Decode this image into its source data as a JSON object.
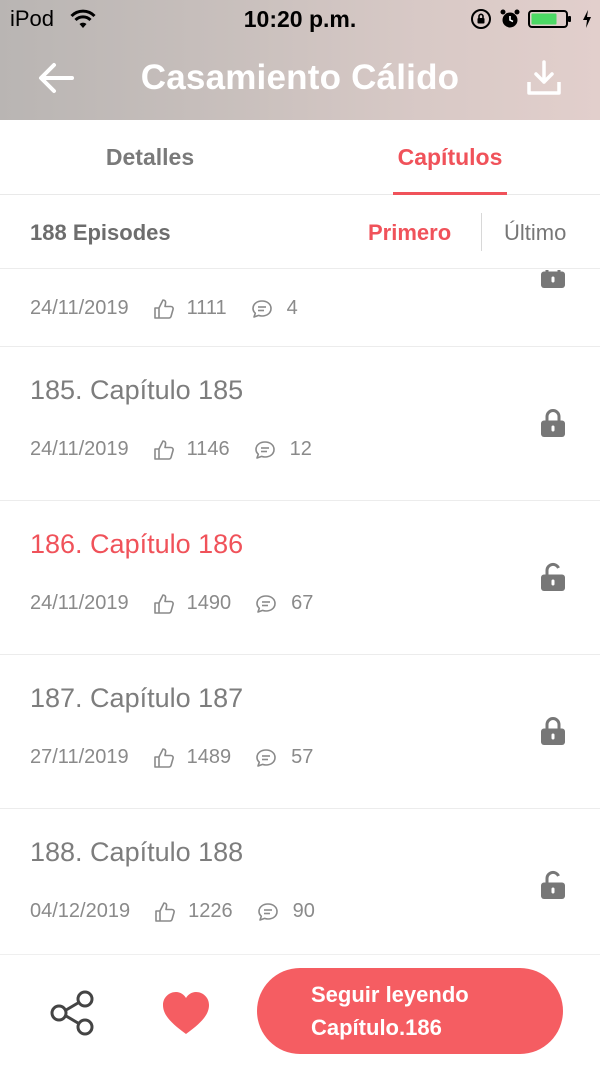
{
  "status_bar": {
    "carrier": "iPod",
    "time": "10:20 p.m."
  },
  "nav": {
    "title": "Casamiento Cálido",
    "back_icon": "arrow-left-icon",
    "download_icon": "download-icon"
  },
  "tabs": [
    {
      "label": "Detalles",
      "active": false
    },
    {
      "label": "Capítulos",
      "active": true
    }
  ],
  "sort_bar": {
    "episode_count": "188 Episodes",
    "first_label": "Primero",
    "last_label": "Último"
  },
  "episodes": [
    {
      "title": "",
      "date": "24/11/2019",
      "likes": "1111",
      "comments": "4",
      "locked": true,
      "current": false
    },
    {
      "title": "185. Capítulo 185",
      "date": "24/11/2019",
      "likes": "1146",
      "comments": "12",
      "locked": true,
      "current": false
    },
    {
      "title": "186. Capítulo 186",
      "date": "24/11/2019",
      "likes": "1490",
      "comments": "67",
      "locked": true,
      "current": true
    },
    {
      "title": "187. Capítulo 187",
      "date": "27/11/2019",
      "likes": "1489",
      "comments": "57",
      "locked": true,
      "current": false
    },
    {
      "title": "188. Capítulo 188",
      "date": "04/12/2019",
      "likes": "1226",
      "comments": "90",
      "locked": true,
      "current": false
    }
  ],
  "bottom_bar": {
    "continue_line1": "Seguir leyendo",
    "continue_line2": "Capítulo.186"
  },
  "colors": {
    "accent": "#f0525a",
    "button": "#f55d62"
  }
}
